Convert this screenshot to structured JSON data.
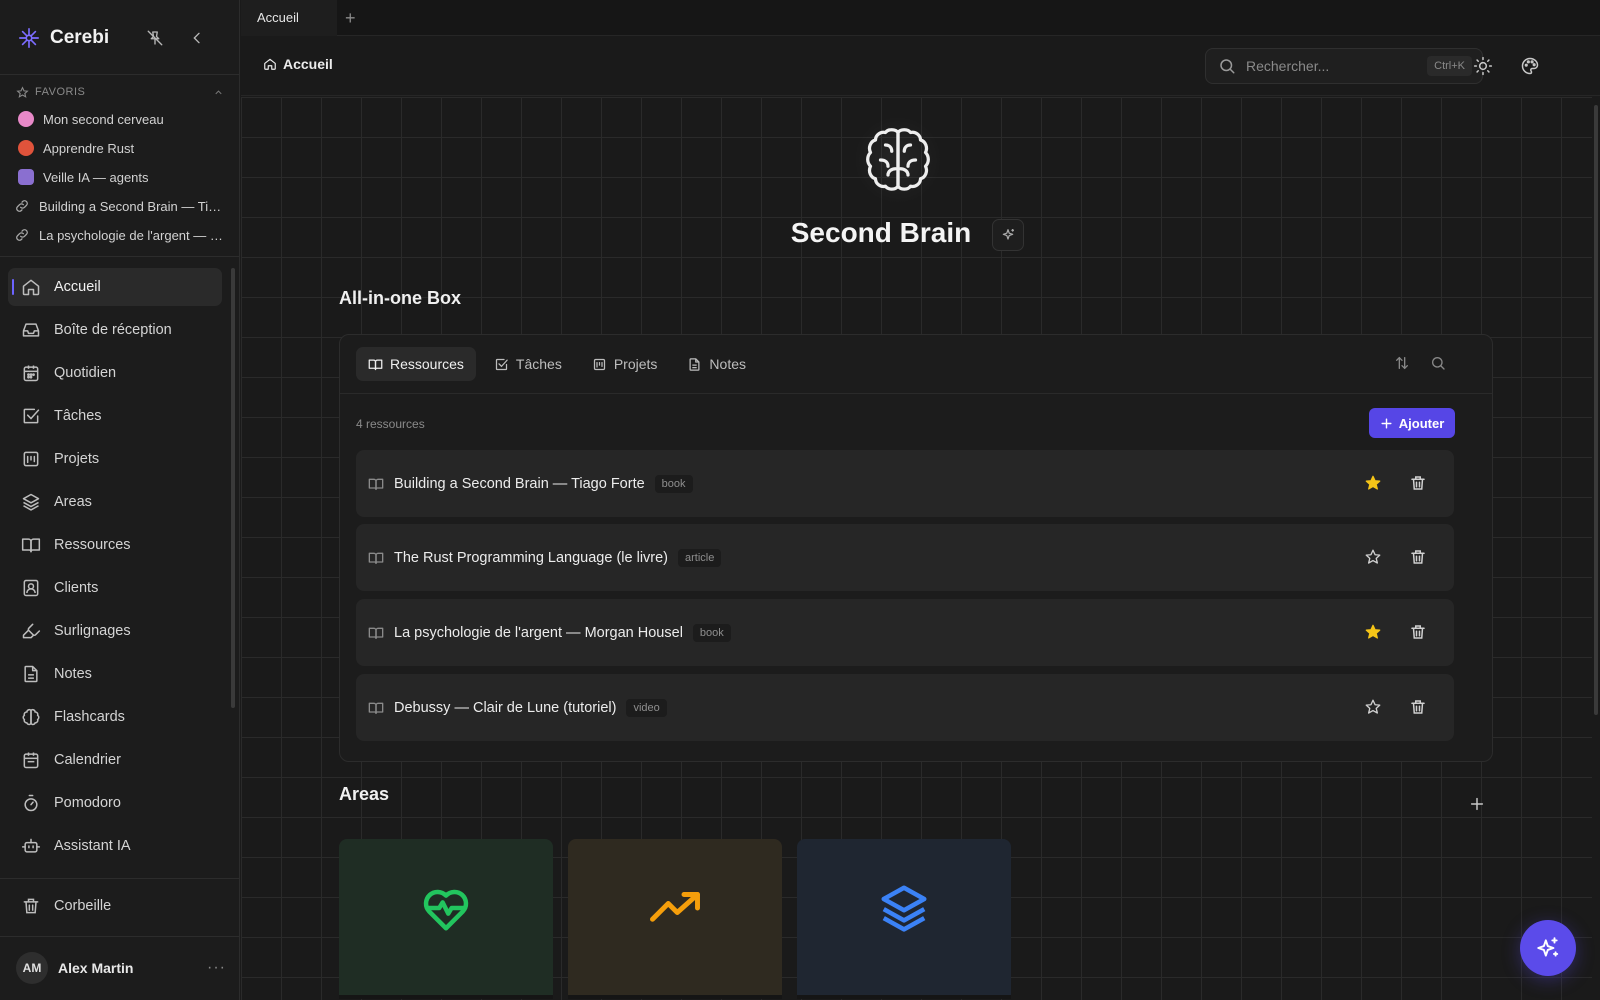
{
  "app": {
    "name": "Cerebi"
  },
  "favorites": {
    "header": "FAVORIS",
    "items": [
      {
        "label": "Mon second cerveau",
        "icon": "brain-emoji",
        "color": "#e889c8"
      },
      {
        "label": "Apprendre Rust",
        "icon": "crab-emoji",
        "color": "#e0533b"
      },
      {
        "label": "Veille IA — agents",
        "icon": "robot-emoji",
        "color": "#8a6fd0"
      },
      {
        "label": "Building a Second Brain — Tiago Forte",
        "icon": "link-icon"
      },
      {
        "label": "La psychologie de l'argent — Morgan Housel",
        "icon": "link-icon"
      }
    ]
  },
  "nav": {
    "items": [
      {
        "label": "Accueil",
        "icon": "home-icon",
        "active": true
      },
      {
        "label": "Boîte de réception",
        "icon": "inbox-icon"
      },
      {
        "label": "Quotidien",
        "icon": "calendar-day-icon"
      },
      {
        "label": "Tâches",
        "icon": "checkbox-icon"
      },
      {
        "label": "Projets",
        "icon": "kanban-icon"
      },
      {
        "label": "Areas",
        "icon": "layers-icon"
      },
      {
        "label": "Ressources",
        "icon": "book-open-icon"
      },
      {
        "label": "Clients",
        "icon": "contact-icon"
      },
      {
        "label": "Surlignages",
        "icon": "highlighter-icon"
      },
      {
        "label": "Notes",
        "icon": "note-icon"
      },
      {
        "label": "Flashcards",
        "icon": "brain-icon"
      },
      {
        "label": "Calendrier",
        "icon": "calendar-icon"
      },
      {
        "label": "Pomodoro",
        "icon": "timer-icon"
      },
      {
        "label": "Assistant IA",
        "icon": "bot-icon"
      }
    ],
    "trash": "Corbeille"
  },
  "user": {
    "initials": "AM",
    "name": "Alex Martin"
  },
  "tabs": {
    "items": [
      "Accueil"
    ],
    "add": "+"
  },
  "header": {
    "breadcrumb": "Accueil",
    "search_placeholder": "Rechercher...",
    "search_shortcut": "Ctrl+K"
  },
  "hero": {
    "title": "Second Brain"
  },
  "box": {
    "title": "All-in-one Box",
    "tabs": [
      {
        "label": "Ressources",
        "icon": "book-open-icon",
        "active": true
      },
      {
        "label": "Tâches",
        "icon": "checkbox-icon"
      },
      {
        "label": "Projets",
        "icon": "kanban-icon"
      },
      {
        "label": "Notes",
        "icon": "note-icon"
      }
    ],
    "count": "4 ressources",
    "add_label": "Ajouter",
    "resources": [
      {
        "title": "Building a Second Brain — Tiago Forte",
        "tag": "book",
        "starred": true
      },
      {
        "title": "The Rust Programming Language (le livre)",
        "tag": "article",
        "starred": false
      },
      {
        "title": "La psychologie de l'argent — Morgan Housel",
        "tag": "book",
        "starred": true
      },
      {
        "title": "Debussy — Clair de Lune (tutoriel)",
        "tag": "video",
        "starred": false
      }
    ]
  },
  "areas": {
    "title": "Areas",
    "cards": [
      {
        "icon": "heart-pulse-icon",
        "bg": "#1f2d24",
        "color": "#22c55e"
      },
      {
        "icon": "trending-up-icon",
        "bg": "#2f2a20",
        "color": "#f59e0b"
      },
      {
        "icon": "layers-icon",
        "bg": "#1f2631",
        "color": "#3b82f6"
      }
    ]
  },
  "colors": {
    "accent": "#5646e6",
    "star": "#f5c518"
  }
}
